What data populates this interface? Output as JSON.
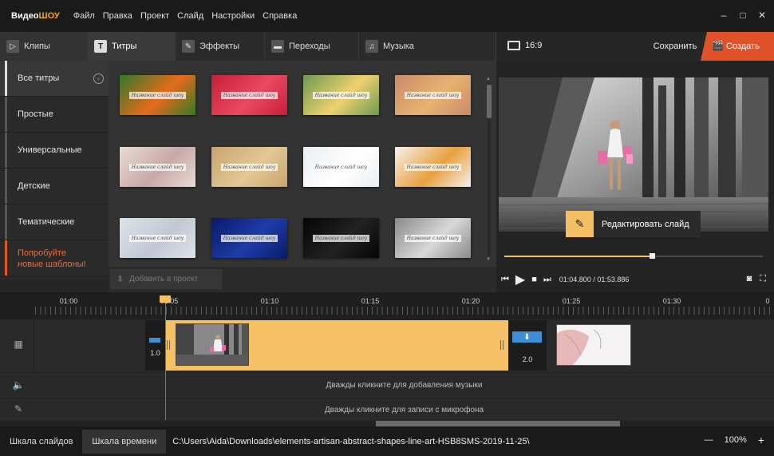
{
  "app": {
    "logo_part1": "Видео",
    "logo_part2": "ШОУ"
  },
  "menu": [
    "Файл",
    "Правка",
    "Проект",
    "Слайд",
    "Настройки",
    "Справка"
  ],
  "window_controls": {
    "minimize": "–",
    "maximize": "□",
    "close": "✕"
  },
  "tabs": [
    {
      "label": "Клипы",
      "icon": "film-icon",
      "glyph": "▷"
    },
    {
      "label": "Титры",
      "icon": "text-icon",
      "glyph": "T"
    },
    {
      "label": "Эффекты",
      "icon": "wand-icon",
      "glyph": "✎"
    },
    {
      "label": "Переходы",
      "icon": "transition-icon",
      "glyph": "▬"
    },
    {
      "label": "Музыка",
      "icon": "music-icon",
      "glyph": "♫"
    }
  ],
  "categories": [
    {
      "label": "Все титры"
    },
    {
      "label": "Простые"
    },
    {
      "label": "Универсальные"
    },
    {
      "label": "Детские"
    },
    {
      "label": "Тематические"
    }
  ],
  "promo": {
    "line1": "Попробуйте",
    "line2": "новые шаблоны!"
  },
  "thumbnails": [
    {
      "caption": "Название слайд шоу",
      "bg": "#2f7a2a",
      "accent": "#e86a1c"
    },
    {
      "caption": "Название слайд шоу",
      "bg": "#c81d3a",
      "accent": "#e84a60"
    },
    {
      "caption": "Название слайд шоу",
      "bg": "#6c9a4e",
      "accent": "#f0d070"
    },
    {
      "caption": "Название слайд шоу",
      "bg": "#c98a6a",
      "accent": "#e7b36f"
    },
    {
      "caption": "Название слайд шоу",
      "bg": "#e8dcd4",
      "accent": "#c8a8a8"
    },
    {
      "caption": "Название слайд шоу",
      "bg": "#c8a46e",
      "accent": "#e2c894"
    },
    {
      "caption": "Название слайд шоу",
      "bg": "#e9eef1",
      "accent": "#ffffff"
    },
    {
      "caption": "Название слайд шоу",
      "bg": "#f6f1ec",
      "accent": "#e8a040"
    },
    {
      "caption": "Название слайд шоу",
      "bg": "#dfe3e8",
      "accent": "#c0c8d4"
    },
    {
      "caption": "Название слайд шоу",
      "bg": "#0a1a6a",
      "accent": "#1e3da8"
    },
    {
      "caption": "Название слайд шоу",
      "bg": "#050505",
      "accent": "#222222"
    },
    {
      "caption": "Название слайд шоу",
      "bg": "#8a8a8a",
      "accent": "#d8d8d8"
    }
  ],
  "add_button": "Добавить в проект",
  "preview_header": {
    "ratio": "16:9",
    "save": "Сохранить",
    "create": "Создать"
  },
  "edit_slide": "Редактировать слайд",
  "player": {
    "current_time": "01:04.800",
    "separator": " / ",
    "total_time": "01:53.886",
    "progress": 0.57
  },
  "ruler": [
    "01:00",
    "01:05",
    "01:10",
    "01:15",
    "01:20",
    "01:25",
    "01:30",
    "0"
  ],
  "timeline": {
    "transition1_duration": "1.0",
    "transition2_duration": "2.0",
    "music_hint": "Дважды кликните для добавления музыки",
    "mic_hint": "Дважды кликните для записи с микрофона"
  },
  "statusbar": {
    "tab_slides": "Шкала слайдов",
    "tab_timeline": "Шкала времени",
    "path": "C:\\Users\\Aida\\Downloads\\elements-artisan-abstract-shapes-line-art-HSB8SMS-2019-11-25\\",
    "zoom_minus": "—",
    "zoom_value": "100%",
    "zoom_plus": "+"
  }
}
